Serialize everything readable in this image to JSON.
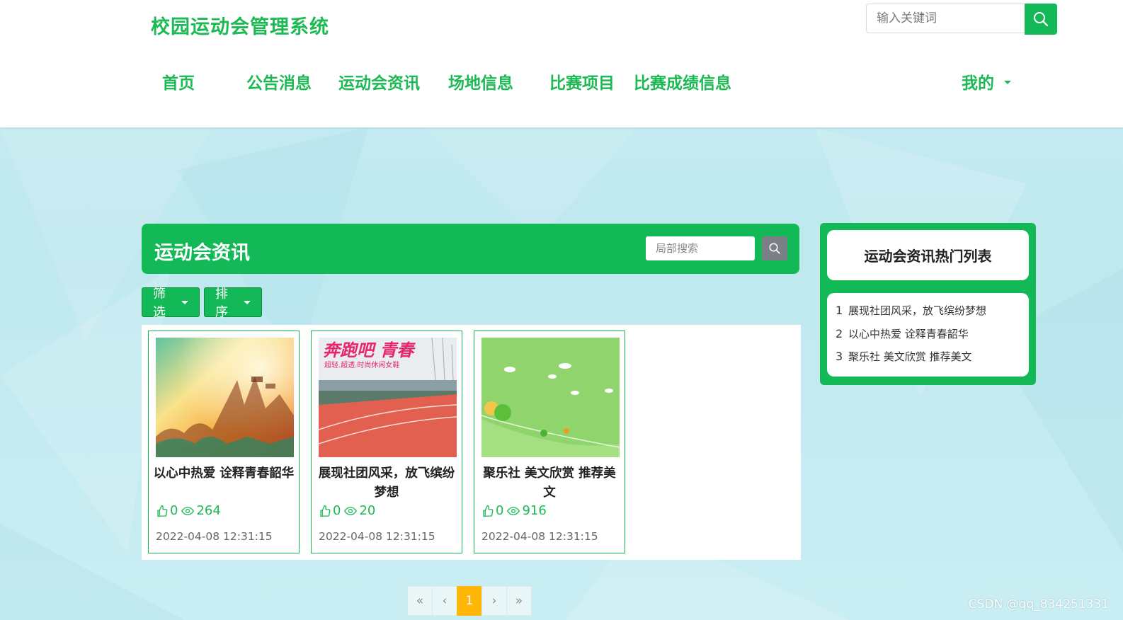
{
  "header": {
    "logo": "校园运动会管理系统",
    "search_placeholder": "输入关键词",
    "nav": [
      "首页",
      "公告消息",
      "运动会资讯",
      "场地信息",
      "比赛项目",
      "比赛成绩信息"
    ],
    "mine_label": "我的"
  },
  "main": {
    "title": "运动会资讯",
    "local_search_placeholder": "局部搜索",
    "filter_label": "筛选",
    "sort_label": "排序",
    "cards": [
      {
        "title": "以心中热爱 诠释青春韶华",
        "likes": "0",
        "views": "264",
        "date": "2022-04-08 12:31:15"
      },
      {
        "title": "展现社团风采，放飞缤纷梦想",
        "likes": "0",
        "views": "20",
        "date": "2022-04-08 12:31:15",
        "banner_big": "奔跑吧 青春",
        "banner_small": "超轻.超透.时尚休闲女鞋"
      },
      {
        "title": "聚乐社 美文欣赏 推荐美文",
        "likes": "0",
        "views": "916",
        "date": "2022-04-08 12:31:15"
      }
    ]
  },
  "side": {
    "title": "运动会资讯热门列表",
    "items": [
      {
        "num": "1",
        "label": "展现社团风采，放飞缤纷梦想"
      },
      {
        "num": "2",
        "label": "以心中热爱 诠释青春韶华"
      },
      {
        "num": "3",
        "label": "聚乐社 美文欣赏 推荐美文"
      }
    ]
  },
  "pagination": {
    "first": "«",
    "prev": "‹",
    "current": "1",
    "next": "›",
    "last": "»"
  },
  "watermark": "CSDN @qq_834251331",
  "colors": {
    "accent": "#14b957",
    "accent_text": "#1db954",
    "page_active": "#ffb606"
  },
  "icons": [
    "search-icon",
    "thumbs-up-icon",
    "eye-icon",
    "caret-down-icon"
  ]
}
